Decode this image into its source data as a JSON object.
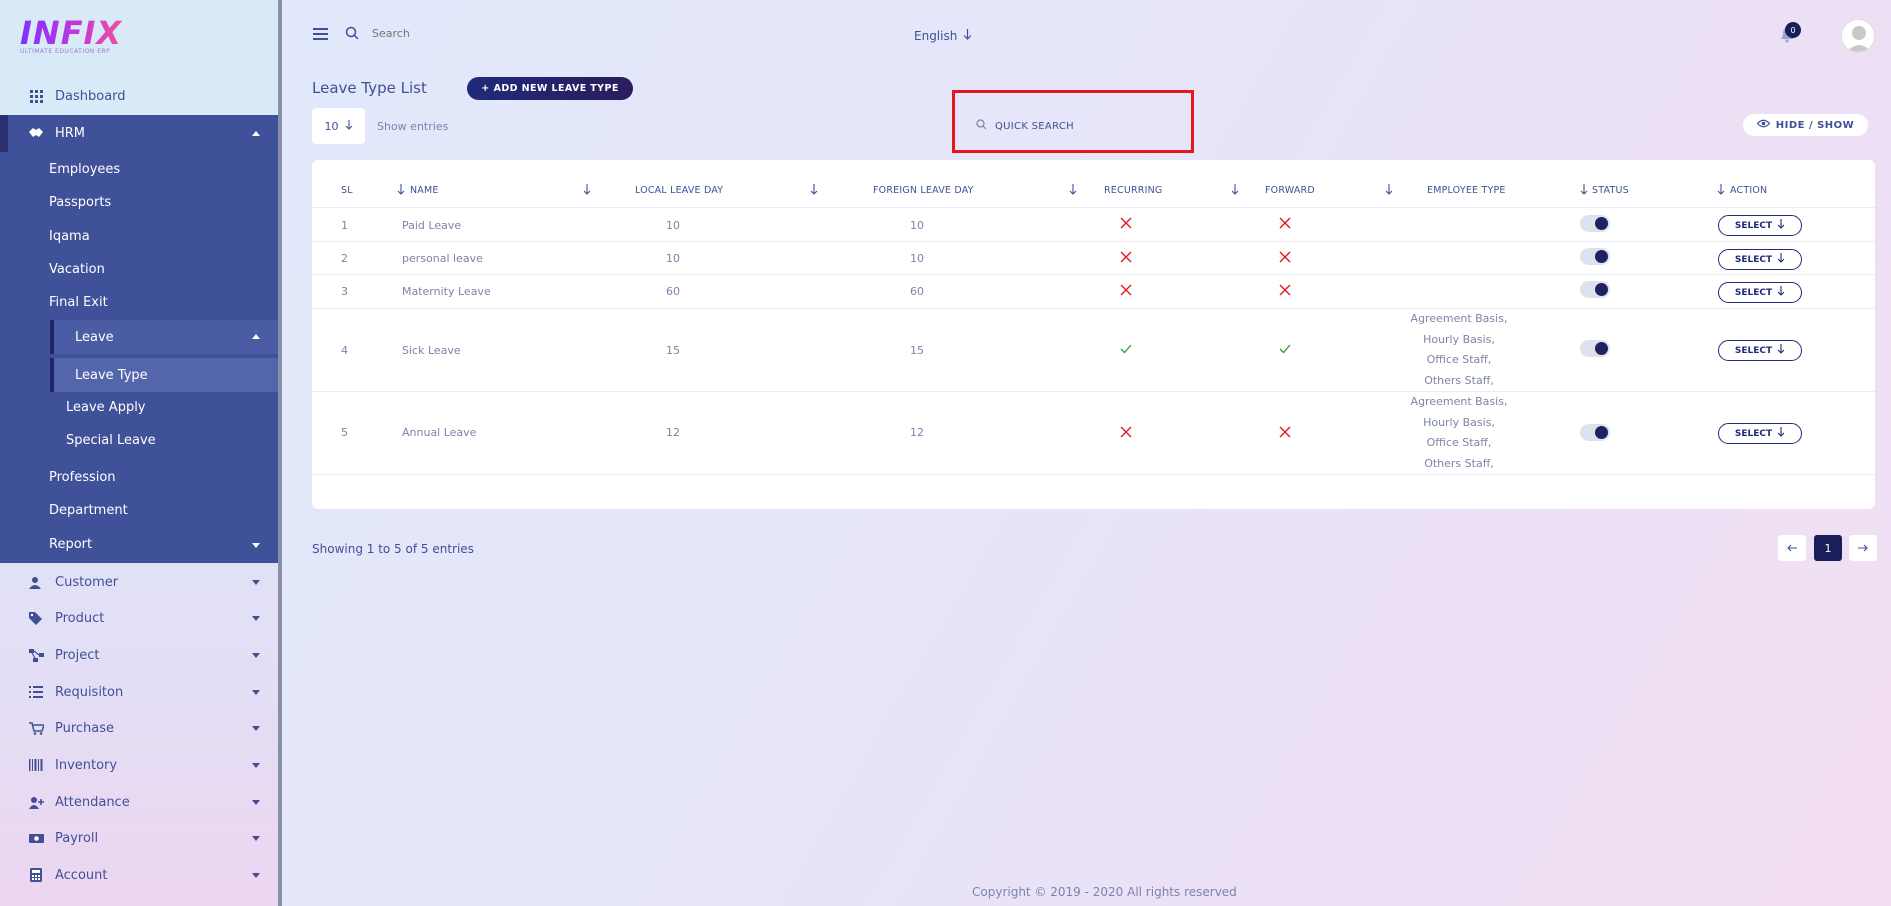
{
  "brand": {
    "logo": "INFIX",
    "tagline": "ULTIMATE EDUCATION ERP"
  },
  "sidebar": {
    "dashboard": "Dashboard",
    "hrm": "HRM",
    "hrm_items": [
      "Employees",
      "Passports",
      "Iqama",
      "Vacation",
      "Final Exit"
    ],
    "leave": "Leave",
    "leave_items": [
      "Leave Type",
      "Leave Apply",
      "Special Leave"
    ],
    "hrm_items_after": [
      "Profession",
      "Department",
      "Report"
    ],
    "modules": [
      "Customer",
      "Product",
      "Project",
      "Requisiton",
      "Purchase",
      "Inventory",
      "Attendance",
      "Payroll",
      "Account"
    ]
  },
  "topbar": {
    "search_placeholder": "Search",
    "language": "English",
    "notification_count": "0"
  },
  "page": {
    "title": "Leave Type List",
    "add_button": "ADD NEW LEAVE TYPE",
    "entries_value": "10",
    "entries_label": "Show entries",
    "quick_search": "QUICK SEARCH",
    "hide_show": "HIDE / SHOW"
  },
  "table": {
    "headers": [
      "SL",
      "NAME",
      "LOCAL LEAVE DAY",
      "FOREIGN LEAVE DAY",
      "RECURRING",
      "FORWARD",
      "EMPLOYEE TYPE",
      "STATUS",
      "ACTION"
    ],
    "rows": [
      {
        "sl": "1",
        "name": "Paid Leave",
        "local": "10",
        "foreign": "10",
        "recurring": false,
        "forward": false,
        "employee_type": [],
        "status": true,
        "action": "SELECT"
      },
      {
        "sl": "2",
        "name": "personal leave",
        "local": "10",
        "foreign": "10",
        "recurring": false,
        "forward": false,
        "employee_type": [],
        "status": true,
        "action": "SELECT"
      },
      {
        "sl": "3",
        "name": "Maternity Leave",
        "local": "60",
        "foreign": "60",
        "recurring": false,
        "forward": false,
        "employee_type": [],
        "status": true,
        "action": "SELECT"
      },
      {
        "sl": "4",
        "name": "Sick Leave",
        "local": "15",
        "foreign": "15",
        "recurring": true,
        "forward": true,
        "employee_type": [
          "Agreement Basis,",
          "Hourly Basis,",
          "Office Staff,",
          "Others Staff,"
        ],
        "status": true,
        "action": "SELECT"
      },
      {
        "sl": "5",
        "name": "Annual Leave",
        "local": "12",
        "foreign": "12",
        "recurring": false,
        "forward": false,
        "employee_type": [
          "Agreement Basis,",
          "Hourly Basis,",
          "Office Staff,",
          "Others Staff,"
        ],
        "status": true,
        "action": "SELECT"
      }
    ]
  },
  "footer": {
    "showing": "Showing 1 to 5 of 5 entries",
    "current_page": "1",
    "copyright": "Copyright © 2019 - 2020 All rights reserved"
  },
  "colors": {
    "primary": "#415094",
    "dark": "#1a1e5a",
    "cross": "#e3181b",
    "check": "#2e9e3b"
  }
}
